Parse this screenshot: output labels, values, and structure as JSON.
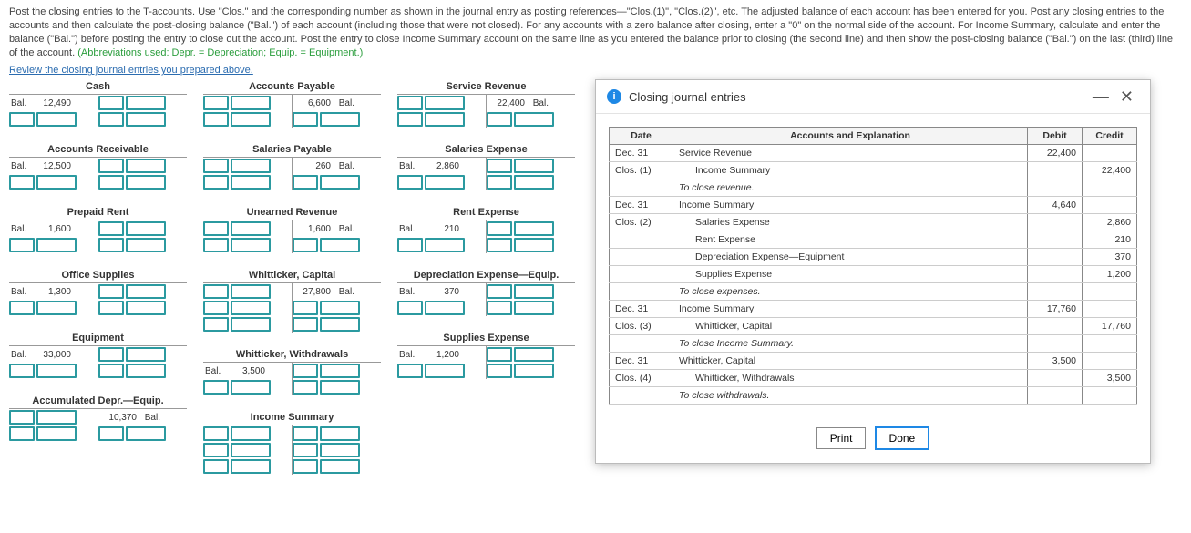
{
  "instructions": {
    "main": "Post the closing entries to the T-accounts. Use \"Clos.\" and the corresponding number as shown in the journal entry as posting references—\"Clos.(1)\", \"Clos.(2)\", etc. The adjusted balance of each account has been entered for you. Post any closing entries to the accounts and then calculate the post-closing balance (\"Bal.\") of each account (including those that were not closed). For any accounts with a zero balance after closing, enter a \"0\" on the normal side of the account. For Income Summary, calculate and enter the balance (\"Bal.\") before posting the entry to close out the account. Post the entry to close Income Summary account on the same line as you entered the balance prior to closing (the second line) and then show the post-closing balance (\"Bal.\") on the last (third) line of the account. ",
    "abbrev": "(Abbreviations used: Depr. = Depreciation; Equip. = Equipment.)"
  },
  "review_link": "Review the closing journal entries you prepared above.",
  "lbl_bal": "Bal.",
  "columns": [
    [
      {
        "title": "Cash",
        "rows": [
          [
            "L",
            "Bal.",
            "12,490",
            "",
            ""
          ],
          [
            "I",
            "",
            "",
            "",
            ""
          ]
        ]
      },
      {
        "title": "Accounts Receivable",
        "rows": [
          [
            "L",
            "Bal.",
            "12,500",
            "",
            ""
          ],
          [
            "I",
            "",
            "",
            "",
            ""
          ]
        ]
      },
      {
        "title": "Prepaid Rent",
        "rows": [
          [
            "L",
            "Bal.",
            "1,600",
            "",
            ""
          ],
          [
            "I",
            "",
            "",
            "",
            ""
          ]
        ]
      },
      {
        "title": "Office Supplies",
        "rows": [
          [
            "L",
            "Bal.",
            "1,300",
            "",
            ""
          ],
          [
            "I",
            "",
            "",
            "",
            ""
          ]
        ]
      },
      {
        "title": "Equipment",
        "rows": [
          [
            "L",
            "Bal.",
            "33,000",
            "",
            ""
          ],
          [
            "I",
            "",
            "",
            "",
            ""
          ]
        ]
      },
      {
        "title": "Accumulated Depr.—Equip.",
        "rows": [
          [
            "R",
            "",
            "",
            "10,370",
            "Bal."
          ],
          [
            "I",
            "",
            "",
            "",
            ""
          ]
        ]
      }
    ],
    [
      {
        "title": "Accounts Payable",
        "rows": [
          [
            "R",
            "",
            "",
            "6,600",
            "Bal."
          ],
          [
            "I",
            "",
            "",
            "",
            ""
          ]
        ]
      },
      {
        "title": "Salaries Payable",
        "rows": [
          [
            "R",
            "",
            "",
            "260",
            "Bal."
          ],
          [
            "I",
            "",
            "",
            "",
            ""
          ]
        ]
      },
      {
        "title": "Unearned Revenue",
        "rows": [
          [
            "R",
            "",
            "",
            "1,600",
            "Bal."
          ],
          [
            "I",
            "",
            "",
            "",
            ""
          ]
        ]
      },
      {
        "title": "Whitticker, Capital",
        "rows": [
          [
            "R",
            "",
            "",
            "27,800",
            "Bal."
          ],
          [
            "I",
            "",
            "",
            "",
            ""
          ],
          [
            "I",
            "",
            "",
            "",
            ""
          ]
        ]
      },
      {
        "title": "Whitticker, Withdrawals",
        "rows": [
          [
            "L",
            "Bal.",
            "3,500",
            "",
            ""
          ],
          [
            "I",
            "",
            "",
            "",
            ""
          ]
        ]
      },
      {
        "title": "Income Summary",
        "rows": [
          [
            "I",
            "",
            "",
            "",
            ""
          ],
          [
            "I",
            "",
            "",
            "",
            ""
          ],
          [
            "I",
            "",
            "",
            "",
            ""
          ]
        ]
      }
    ],
    [
      {
        "title": "Service Revenue",
        "rows": [
          [
            "R",
            "",
            "",
            "22,400",
            "Bal."
          ],
          [
            "I",
            "",
            "",
            "",
            ""
          ]
        ]
      },
      {
        "title": "Salaries Expense",
        "rows": [
          [
            "L",
            "Bal.",
            "2,860",
            "",
            ""
          ],
          [
            "I",
            "",
            "",
            "",
            ""
          ]
        ]
      },
      {
        "title": "Rent Expense",
        "rows": [
          [
            "L",
            "Bal.",
            "210",
            "",
            ""
          ],
          [
            "I",
            "",
            "",
            "",
            ""
          ]
        ]
      },
      {
        "title": "Depreciation Expense—Equip.",
        "rows": [
          [
            "L",
            "Bal.",
            "370",
            "",
            ""
          ],
          [
            "I",
            "",
            "",
            "",
            ""
          ]
        ]
      },
      {
        "title": "Supplies Expense",
        "rows": [
          [
            "L",
            "Bal.",
            "1,200",
            "",
            ""
          ],
          [
            "I",
            "",
            "",
            "",
            ""
          ]
        ]
      }
    ]
  ],
  "dialog": {
    "title": "Closing journal entries",
    "headers": {
      "date": "Date",
      "acc": "Accounts and Explanation",
      "debit": "Debit",
      "credit": "Credit"
    },
    "buttons": {
      "print": "Print",
      "done": "Done"
    },
    "rows": [
      {
        "date": "Dec. 31",
        "acc": "Service Revenue",
        "indent": 0,
        "debit": "22,400",
        "credit": ""
      },
      {
        "date": "Clos. (1)",
        "acc": "Income Summary",
        "indent": 1,
        "debit": "",
        "credit": "22,400"
      },
      {
        "date": "",
        "acc": "To close revenue.",
        "indent": 0,
        "italic": true,
        "debit": "",
        "credit": ""
      },
      {
        "date": "Dec. 31",
        "acc": "Income Summary",
        "indent": 0,
        "debit": "4,640",
        "credit": ""
      },
      {
        "date": "Clos. (2)",
        "acc": "Salaries Expense",
        "indent": 1,
        "debit": "",
        "credit": "2,860"
      },
      {
        "date": "",
        "acc": "Rent Expense",
        "indent": 1,
        "debit": "",
        "credit": "210"
      },
      {
        "date": "",
        "acc": "Depreciation Expense—Equipment",
        "indent": 1,
        "debit": "",
        "credit": "370"
      },
      {
        "date": "",
        "acc": "Supplies Expense",
        "indent": 1,
        "debit": "",
        "credit": "1,200"
      },
      {
        "date": "",
        "acc": "To close expenses.",
        "indent": 0,
        "italic": true,
        "debit": "",
        "credit": ""
      },
      {
        "date": "Dec. 31",
        "acc": "Income Summary",
        "indent": 0,
        "debit": "17,760",
        "credit": ""
      },
      {
        "date": "Clos. (3)",
        "acc": "Whitticker, Capital",
        "indent": 1,
        "debit": "",
        "credit": "17,760"
      },
      {
        "date": "",
        "acc": "To close Income Summary.",
        "indent": 0,
        "italic": true,
        "debit": "",
        "credit": ""
      },
      {
        "date": "Dec. 31",
        "acc": "Whitticker, Capital",
        "indent": 0,
        "debit": "3,500",
        "credit": ""
      },
      {
        "date": "Clos. (4)",
        "acc": "Whitticker, Withdrawals",
        "indent": 1,
        "debit": "",
        "credit": "3,500"
      },
      {
        "date": "",
        "acc": "To close withdrawals.",
        "indent": 0,
        "italic": true,
        "debit": "",
        "credit": ""
      }
    ]
  }
}
